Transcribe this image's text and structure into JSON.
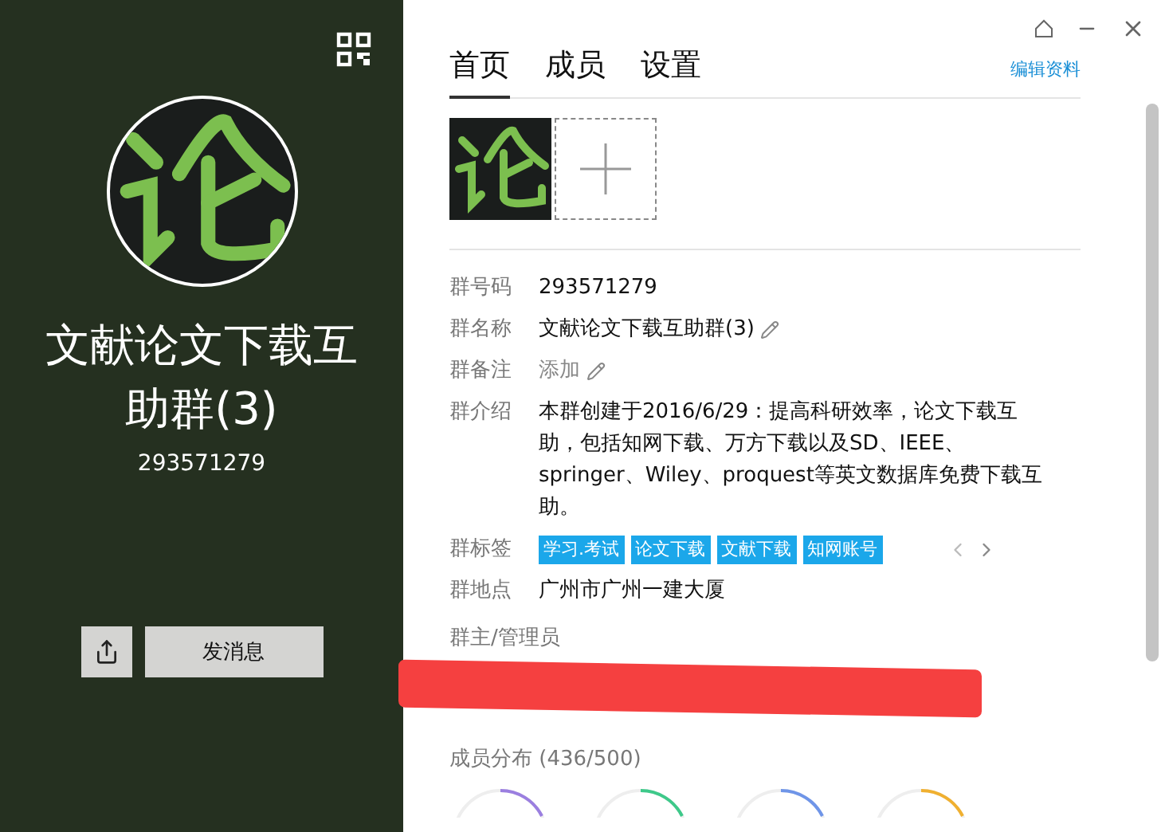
{
  "profile": {
    "name": "文献论文下载互助群(3)",
    "number": "293571279",
    "send_button": "发消息"
  },
  "tabs": [
    {
      "label": "首页",
      "selected": true
    },
    {
      "label": "成员",
      "selected": false
    },
    {
      "label": "设置",
      "selected": false
    }
  ],
  "edit_link": "编辑资料",
  "fields": [
    {
      "kind": "text",
      "label": "群号码",
      "value": "293571279"
    },
    {
      "kind": "editable",
      "label": "群名称",
      "value": "文献论文下载互助群(3)"
    },
    {
      "kind": "placeholder",
      "label": "群备注",
      "placeholder": "添加"
    },
    {
      "kind": "text",
      "label": "群介绍",
      "value": "本群创建于2016/6/29：提高科研效率，论文下载互助，包括知网下载、万方下载以及SD、IEEE、springer、Wiley、proquest等英文数据库免费下载互助。"
    },
    {
      "kind": "tags",
      "label": "群标签",
      "tags": [
        "学习.考试",
        "论文下载",
        "文献下载",
        "知网账号"
      ]
    },
    {
      "kind": "text",
      "label": "群地点",
      "value": "广州市广州一建大厦"
    }
  ],
  "admins": {
    "title": "群主/管理员"
  },
  "distribution": {
    "title": "成员分布 (436/500)",
    "rings": [
      {
        "color": "#9b7fe0"
      },
      {
        "color": "#3ec98a"
      },
      {
        "color": "#6f95e8"
      },
      {
        "color": "#f0b030"
      }
    ]
  }
}
